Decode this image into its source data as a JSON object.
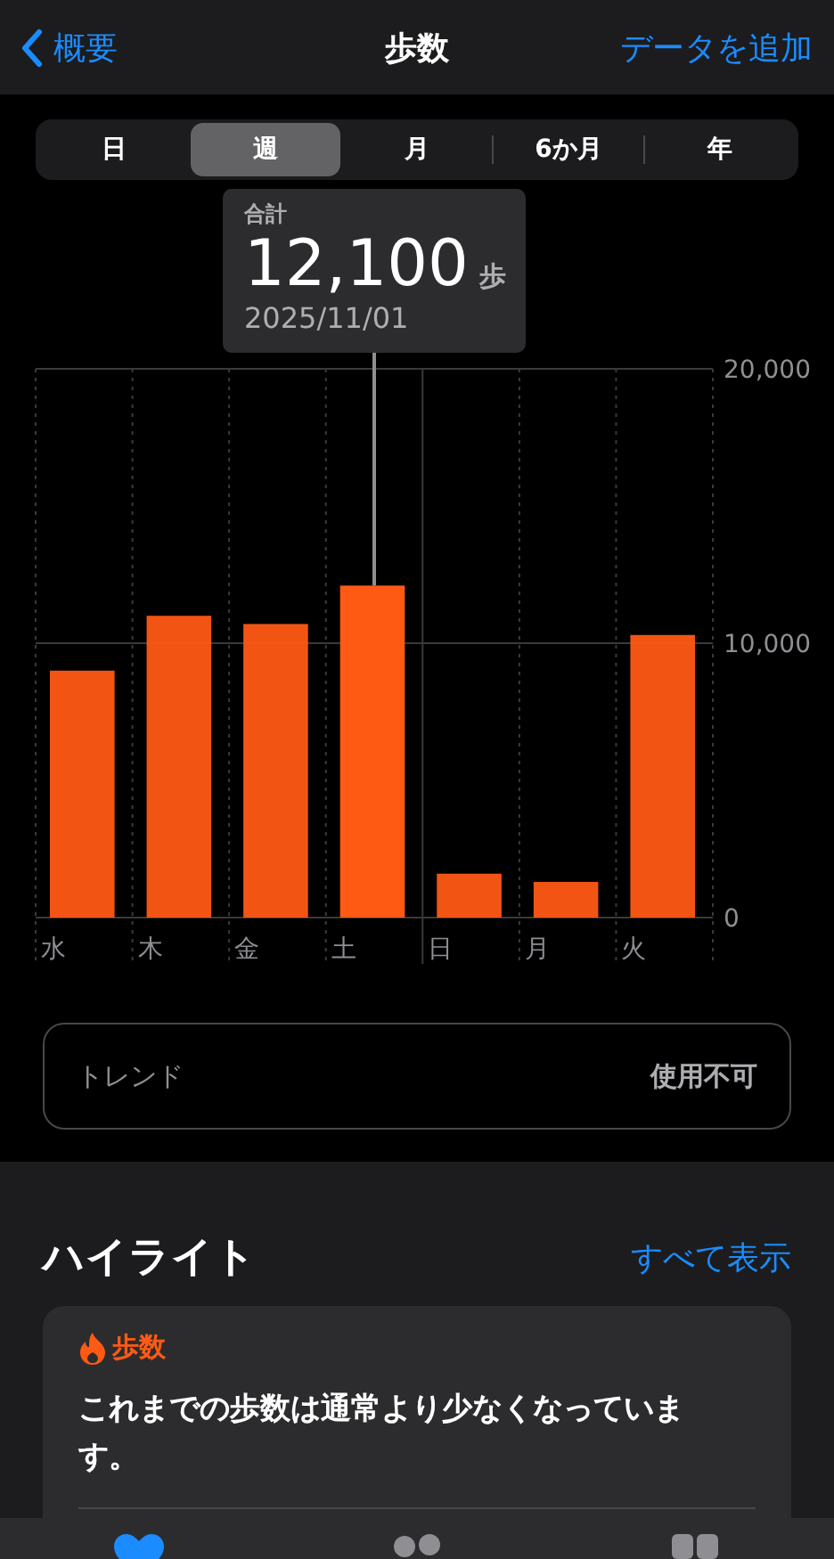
{
  "nav": {
    "back": "概要",
    "title": "歩数",
    "action": "データを追加"
  },
  "segments": [
    {
      "label": "日",
      "selected": false
    },
    {
      "label": "週",
      "selected": true
    },
    {
      "label": "月",
      "selected": false
    },
    {
      "label": "6か月",
      "selected": false
    },
    {
      "label": "年",
      "selected": false
    }
  ],
  "tooltip": {
    "label": "合計",
    "value": "12,100",
    "unit": "歩",
    "date": "2025/11/01"
  },
  "chart": {
    "chart_data": {
      "type": "bar",
      "categories": [
        "水",
        "木",
        "金",
        "土",
        "日",
        "月",
        "火"
      ],
      "series": [
        {
          "color": "#ff5a14",
          "values": [
            9000,
            11000,
            10700,
            12100,
            1600,
            1300,
            10300
          ]
        }
      ],
      "ylim": [
        0,
        20000
      ],
      "yticks": [
        {
          "value": 0,
          "label": "0"
        },
        {
          "value": 10000,
          "label": "10,000"
        },
        {
          "value": 20000,
          "label": "20,000"
        }
      ]
    },
    "columns": [
      {
        "selected": false
      },
      {
        "selected": false
      },
      {
        "selected": false
      },
      {
        "selected": true
      },
      {
        "selected": false
      },
      {
        "selected": false
      },
      {
        "selected": false
      }
    ]
  },
  "trend": {
    "label": "トレンド",
    "value": "使用不可"
  },
  "highlights": {
    "title": "ハイライト",
    "link": "すべて表示",
    "card": {
      "category": "歩数",
      "text": "これまでの歩数は通常より少なくなっています。"
    }
  },
  "tab_bar": [
    {
      "kind": "heart",
      "selected": true
    },
    {
      "kind": "dots",
      "selected": false
    },
    {
      "kind": "grid",
      "selected": false
    }
  ]
}
